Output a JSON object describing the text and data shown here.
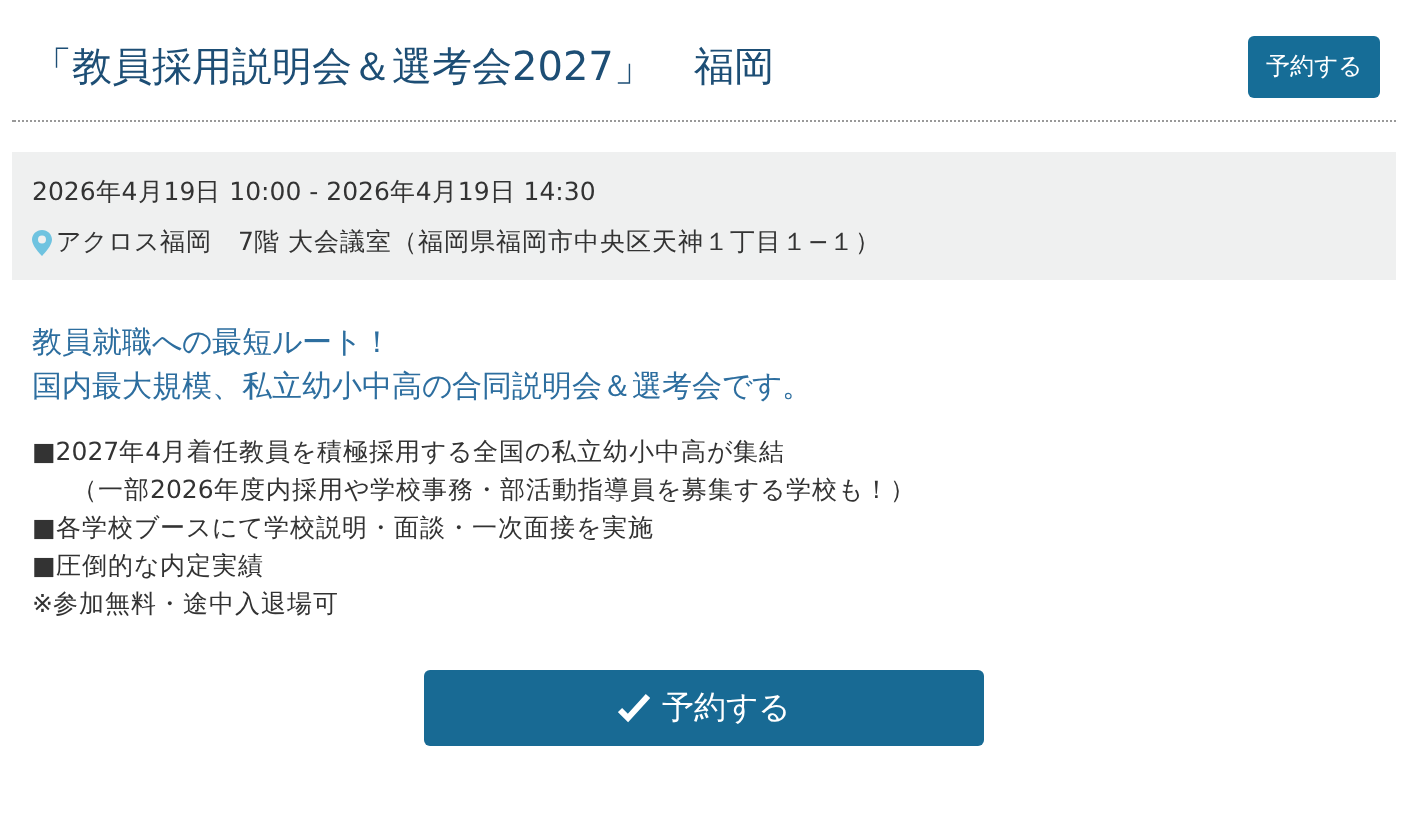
{
  "header": {
    "title": "「教員採用説明会＆選考会2027」　福岡",
    "reserve_button": "予約する"
  },
  "details": {
    "datetime": "2026年4月19日 10:00 - 2026年4月19日 14:30",
    "venue": "アクロス福岡　7階 大会議室（福岡県福岡市中央区天神１丁目１−１）"
  },
  "lead": [
    "教員就職への最短ルート！",
    "国内最大規模、私立幼小中高の合同説明会＆選考会です。"
  ],
  "points": [
    {
      "kind": "line",
      "text": "■2027年4月着任教員を積極採用する全国の私立幼小中高が集結"
    },
    {
      "kind": "indent",
      "text": "（一部2026年度内採用や学校事務・部活動指導員を募集する学校も！）"
    },
    {
      "kind": "line",
      "text": "■各学校ブースにて学校説明・面談・一次面接を実施"
    },
    {
      "kind": "line",
      "text": "■圧倒的な内定実績"
    },
    {
      "kind": "line",
      "text": "※参加無料・途中入退場可"
    }
  ],
  "main_button": "予約する"
}
